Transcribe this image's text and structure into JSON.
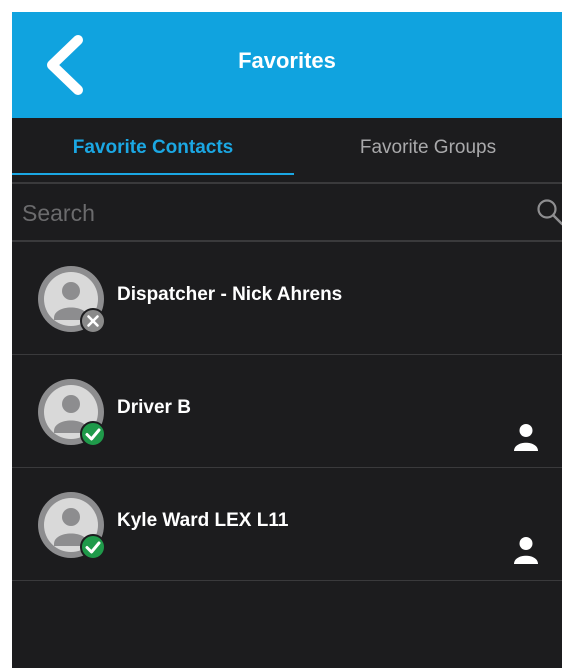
{
  "header": {
    "title": "Favorites",
    "back_icon": "chevron-left-icon"
  },
  "tabs": [
    {
      "label": "Favorite Contacts",
      "active": true
    },
    {
      "label": "Favorite Groups",
      "active": false
    }
  ],
  "search": {
    "placeholder": "Search",
    "value": "",
    "icon": "search-icon"
  },
  "contacts": [
    {
      "name": "Dispatcher - Nick Ahrens",
      "status": "offline",
      "show_person_icon": false
    },
    {
      "name": "Driver B",
      "status": "online",
      "show_person_icon": true
    },
    {
      "name": "Kyle Ward LEX L11",
      "status": "online",
      "show_person_icon": true
    }
  ],
  "colors": {
    "header": "#10a3df",
    "accent": "#1ba7e3",
    "background": "#1c1c1e",
    "online": "#1f9a4a",
    "offline": "#8a8a8a"
  }
}
